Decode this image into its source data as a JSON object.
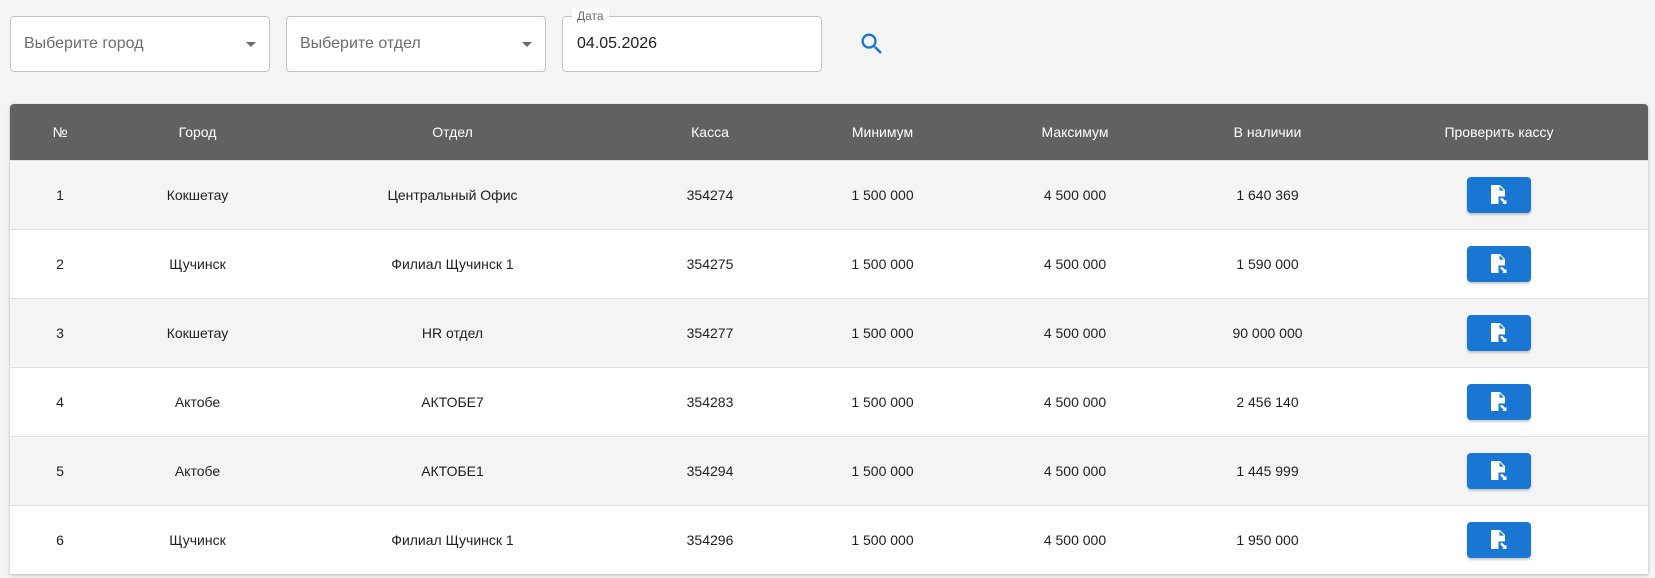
{
  "filters": {
    "city_placeholder": "Выберите город",
    "department_placeholder": "Выберите отдел",
    "date_label": "Дата",
    "date_value": "04.05.2026",
    "search_icon": "search-icon"
  },
  "colors": {
    "accent": "#1976d2",
    "header_bg": "#616161",
    "row_alt": "#f4f4f4"
  },
  "table": {
    "headers": {
      "num": "№",
      "city": "Город",
      "department": "Отдел",
      "cashbox": "Касса",
      "minimum": "Минимум",
      "maximum": "Максимум",
      "available": "В наличии",
      "check": "Проверить кассу"
    },
    "rows": [
      {
        "num": "1",
        "city": "Кокшетау",
        "department": "Центральный Офис",
        "cashbox": "354274",
        "minimum": "1 500 000",
        "maximum": "4 500 000",
        "available": "1 640 369"
      },
      {
        "num": "2",
        "city": "Щучинск",
        "department": "Филиал Щучинск 1",
        "cashbox": "354275",
        "minimum": "1 500 000",
        "maximum": "4 500 000",
        "available": "1 590 000"
      },
      {
        "num": "3",
        "city": "Кокшетау",
        "department": "HR отдел",
        "cashbox": "354277",
        "minimum": "1 500 000",
        "maximum": "4 500 000",
        "available": "90 000 000"
      },
      {
        "num": "4",
        "city": "Актобе",
        "department": "АКТОБЕ7",
        "cashbox": "354283",
        "minimum": "1 500 000",
        "maximum": "4 500 000",
        "available": "2 456 140"
      },
      {
        "num": "5",
        "city": "Актобе",
        "department": "АКТОБЕ1",
        "cashbox": "354294",
        "minimum": "1 500 000",
        "maximum": "4 500 000",
        "available": "1 445 999"
      },
      {
        "num": "6",
        "city": "Щучинск",
        "department": "Филиал Щучинск 1",
        "cashbox": "354296",
        "minimum": "1 500 000",
        "maximum": "4 500 000",
        "available": "1 950 000"
      }
    ],
    "check_icon": "file-check-icon"
  }
}
